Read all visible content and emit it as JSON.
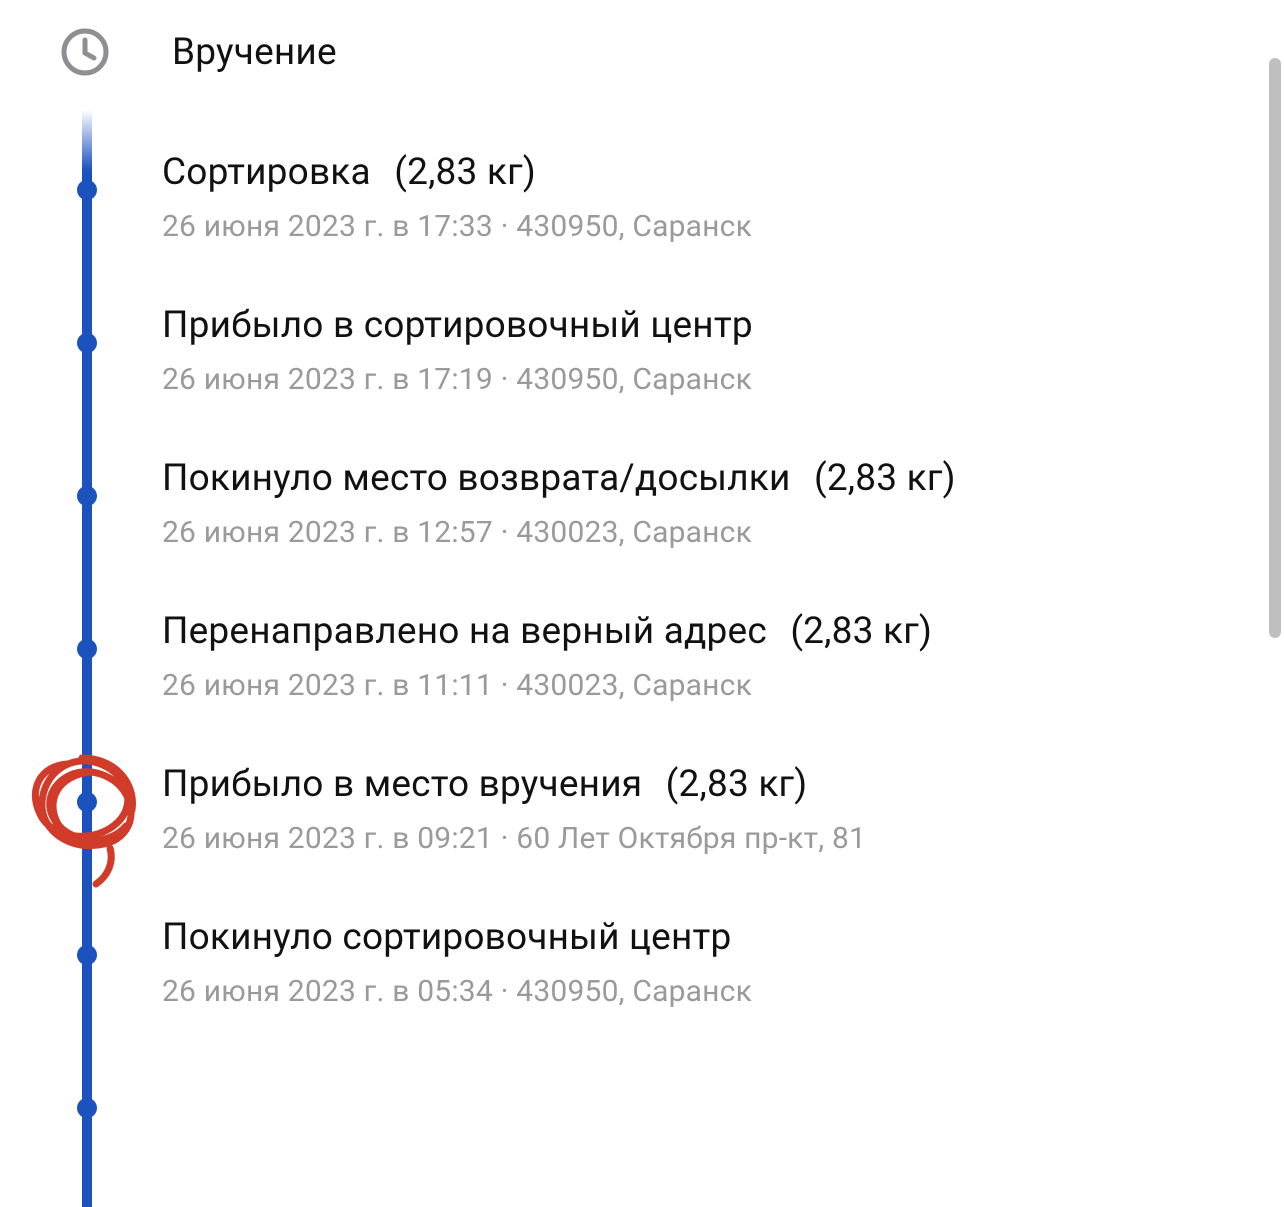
{
  "colors": {
    "accent": "#1c52be",
    "text_primary": "#111111",
    "text_secondary": "#9a9a9a",
    "annotation_red": "#d13c2a",
    "scrollbar": "#bfbfbf"
  },
  "header": {
    "title": "Вручение",
    "icon": "clock-icon"
  },
  "events": [
    {
      "title": "Сортировка",
      "weight": "(2,83 кг)",
      "datetime": "26 июня 2023 г. в 17:33",
      "location": "430950, Саранск"
    },
    {
      "title": "Прибыло в сортировочный центр",
      "weight": "",
      "datetime": "26 июня 2023 г. в 17:19",
      "location": "430950, Саранск"
    },
    {
      "title": "Покинуло место возврата/досылки",
      "weight": "(2,83 кг)",
      "datetime": "26 июня 2023 г. в 12:57",
      "location": "430023, Саранск"
    },
    {
      "title": "Перенаправлено на верный адрес",
      "weight": "(2,83 кг)",
      "datetime": "26 июня 2023 г. в 11:11",
      "location": "430023, Саранск"
    },
    {
      "title": "Прибыло в место вручения",
      "weight": "(2,83 кг)",
      "datetime": "26 июня 2023 г. в 09:21",
      "location": "60 Лет Октября пр-кт, 81"
    },
    {
      "title": "Покинуло сортировочный центр",
      "weight": "",
      "datetime": "26 июня 2023 г. в 05:34",
      "location": "430950, Саранск"
    }
  ]
}
